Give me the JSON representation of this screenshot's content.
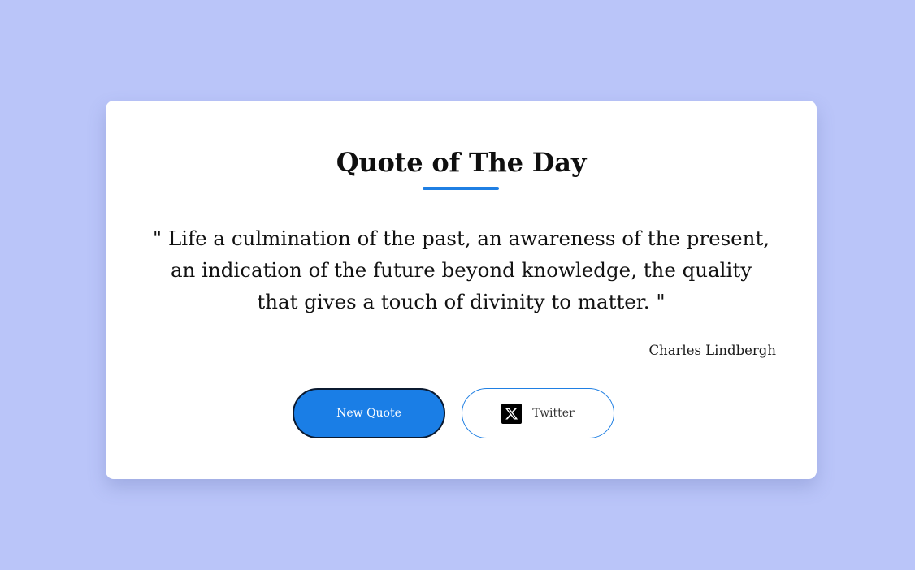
{
  "card": {
    "title": "Quote of The Day",
    "quote": "\" Life a culmination of the past, an awareness of the present, an indication of the future beyond knowledge, the quality that gives a touch of divinity to matter. \"",
    "author": "Charles Lindbergh"
  },
  "buttons": {
    "new_quote_label": "New Quote",
    "twitter_label": "Twitter",
    "twitter_icon": "x-logo-icon"
  },
  "colors": {
    "background": "#bac5f9",
    "accent": "#1a7ee6",
    "card": "#ffffff"
  }
}
